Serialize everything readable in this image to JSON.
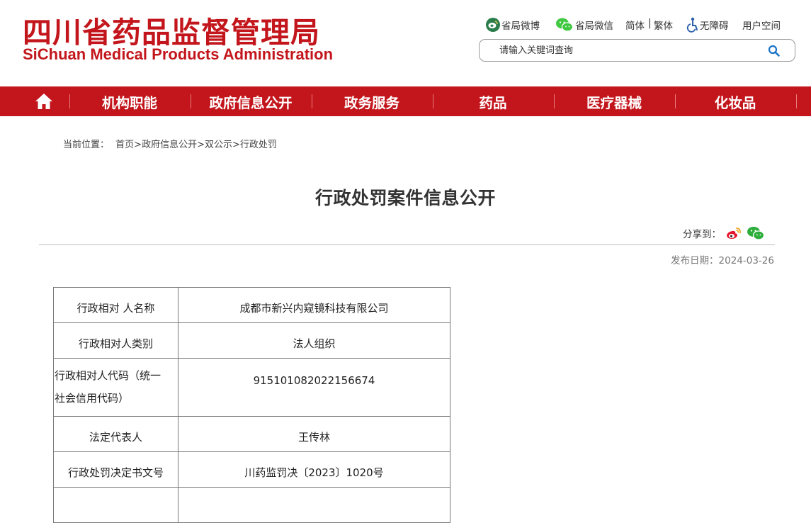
{
  "header": {
    "logo_cn": "四川省药品监督管理局",
    "logo_en": "SiChuan Medical Products Administration",
    "links": {
      "weibo": "省局微博",
      "wechat": "省局微信",
      "simplified": "简体",
      "separator": "|",
      "traditional": "繁体",
      "accessibility": "无障碍",
      "user_space": "用户空间"
    },
    "search": {
      "placeholder": "请输入关键词查询"
    }
  },
  "nav": {
    "home_icon": "home-icon",
    "items": [
      "机构职能",
      "政府信息公开",
      "政务服务",
      "药品",
      "医疗器械",
      "化妆品"
    ]
  },
  "breadcrumb": {
    "prefix": "当前位置：",
    "items": [
      "首页",
      "政府信息公开",
      "双公示",
      "行政处罚"
    ],
    "separator": ">"
  },
  "article": {
    "title": "行政处罚案件信息公开",
    "share_label": "分享到：",
    "share_icons": [
      "weibo-icon",
      "wechat-icon"
    ],
    "date_label": "发布日期：",
    "date": "2024-03-26",
    "rows": [
      {
        "key": "行政相对 人名称",
        "value": "成都市新兴内窥镜科技有限公司"
      },
      {
        "key": "行政相对人类别",
        "value": "法人组织"
      },
      {
        "key_line1": "行政相对人代码（统一",
        "key_line2": "社会信用代码）",
        "value": "915101082022156674"
      },
      {
        "key": "法定代表人",
        "value": "王传林"
      },
      {
        "key": "行政处罚决定书文号",
        "value": "川药监罚决〔2023〕1020号"
      }
    ]
  },
  "colors": {
    "brand_red": "#c3161c",
    "nav_divider": "#e87b7e",
    "weibo_green": "#2c7d4c"
  }
}
